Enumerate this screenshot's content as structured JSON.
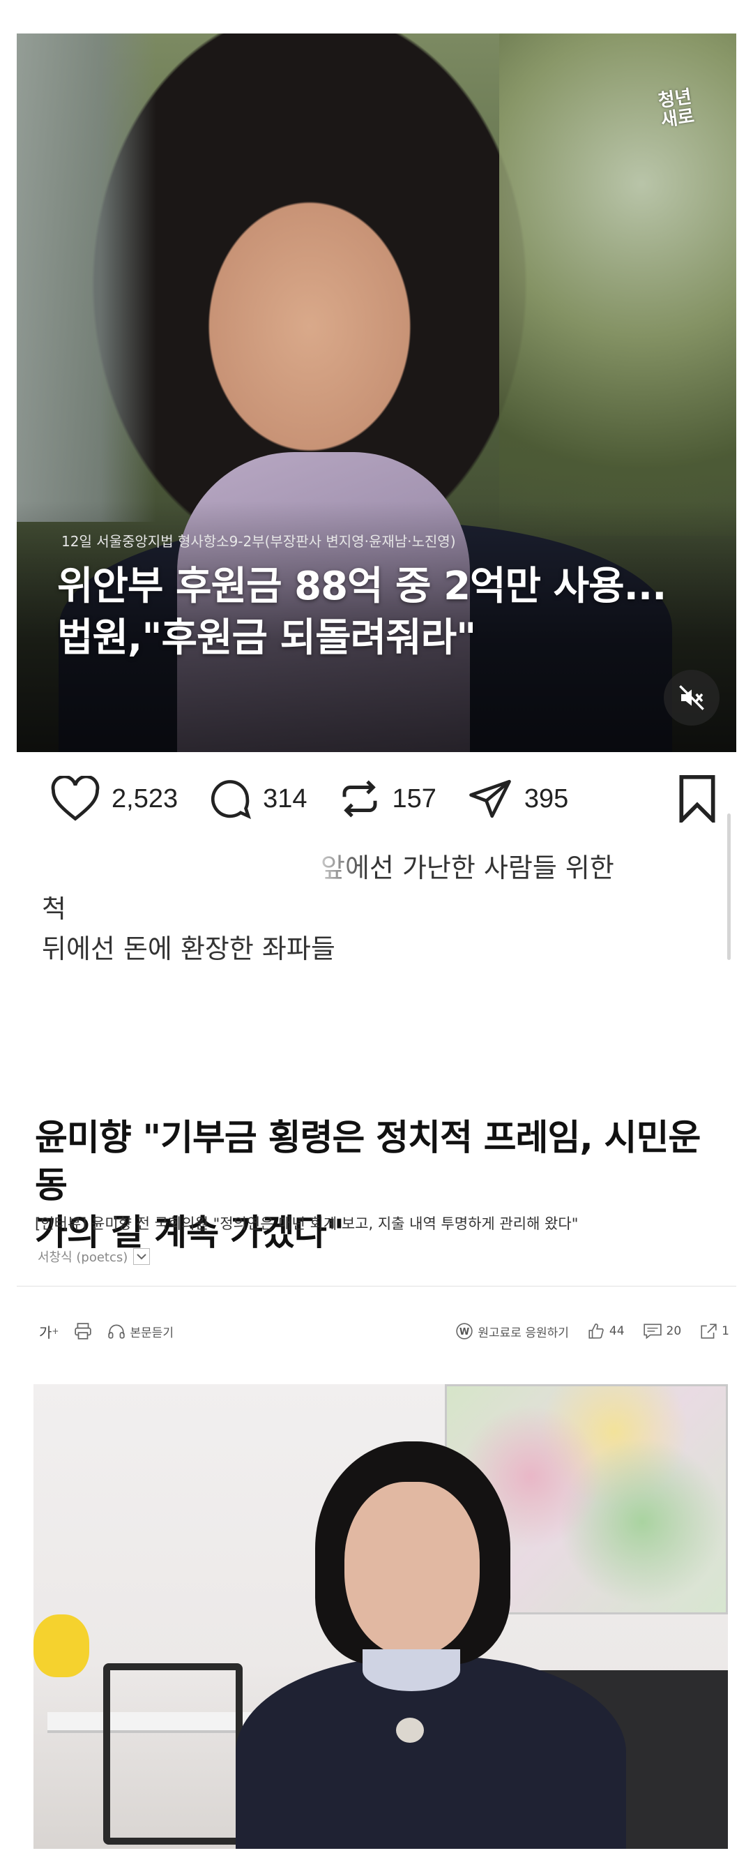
{
  "video": {
    "channel_logo": "청년\n새로",
    "caption_small": "12일 서울중앙지법 형사항소9-2부(부장판사 변지영·윤재남·노진영)",
    "caption_line1": "위안부 후원금 88억 중 2억만 사용...",
    "caption_line2": "법원,\"후원금 되돌려줘라\"",
    "mute_icon": "speaker-muted-icon"
  },
  "actions": {
    "likes": "2,523",
    "comments": "314",
    "reposts": "157",
    "shares": "395"
  },
  "comment": {
    "line1": "앞에선 가난한 사람들 위한",
    "line2": "척",
    "line3": "뒤에선 돈에 환장한 좌파들"
  },
  "article": {
    "headline_line1": "윤미향 \"기부금 횡령은 정치적 프레임, 시민운동",
    "headline_line2": "가의 길 계속 가겠다\"",
    "subtitle": "[인터뷰] 윤미향 전 국회의원 \"정의연은 매년 회계 보고, 지출 내역 투명하게 관리해 왔다\"",
    "author": "서창식 (poetcs)",
    "toolbar": {
      "font_size": "가",
      "font_size_sup": "+",
      "listen": "본문듣기",
      "support": "원고료로 응원하기",
      "likes": "44",
      "comments": "20",
      "shares": "1"
    }
  }
}
